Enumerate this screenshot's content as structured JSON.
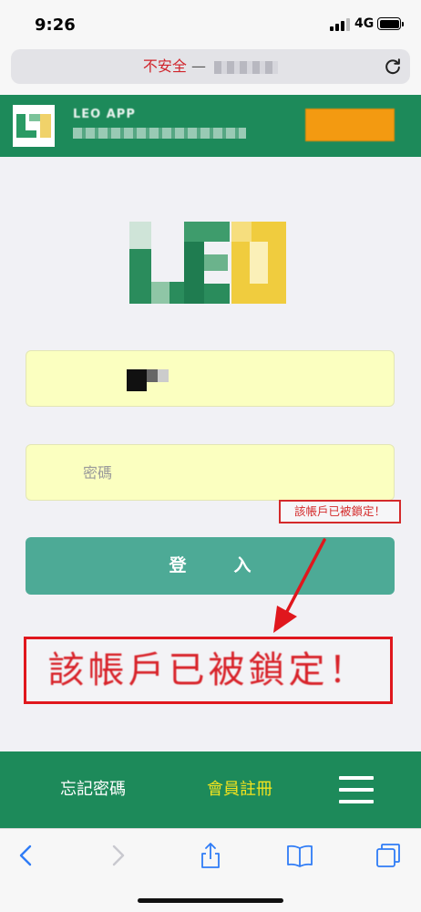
{
  "status_bar": {
    "time": "9:26",
    "network": "4G"
  },
  "url_bar": {
    "insecure_label": "不安全",
    "separator": " — "
  },
  "app_banner": {
    "title": "LEO APP",
    "colors": {
      "banner": "#1d8a5a",
      "button": "#f39a11"
    }
  },
  "login_form": {
    "password_placeholder": "密碼",
    "login_button": "登入",
    "error_small": "該帳戶已被鎖定！",
    "error_big": "該帳戶已被鎖定！"
  },
  "bottom_nav": {
    "forgot_password": "忘記密碼",
    "register": "會員註冊",
    "menu_icon": "hamburger-menu-icon"
  },
  "toolbar": {
    "icons": [
      "back-icon",
      "forward-icon",
      "share-icon",
      "bookmarks-icon",
      "tabs-icon"
    ]
  },
  "colors": {
    "accent_green": "#1d8a5a",
    "button_teal": "#4daa96",
    "error_red": "#d8232a",
    "input_bg": "#fbffc0",
    "register_yellow": "#f2e31e"
  }
}
